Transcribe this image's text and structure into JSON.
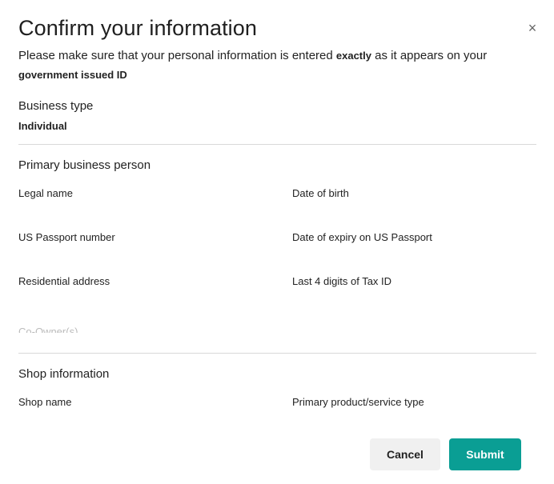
{
  "dialog": {
    "title": "Confirm your information",
    "close_glyph": "×",
    "subtitle_before": "Please make sure that your personal information is entered ",
    "subtitle_emphasis": "exactly",
    "subtitle_after": " as it appears on your ",
    "subtitle_line2": "government issued ID"
  },
  "business": {
    "heading": "Business type",
    "value": "Individual"
  },
  "primary_person": {
    "heading": "Primary business person",
    "fields": {
      "legal_name": "Legal name",
      "date_of_birth": "Date of birth",
      "passport_number": "US Passport number",
      "passport_expiry": "Date of expiry on US Passport",
      "residential_address": "Residential address",
      "tax_id": "Last 4 digits of Tax ID"
    },
    "faded_text": "Co-Owner(s)"
  },
  "shop": {
    "heading": "Shop information",
    "fields": {
      "shop_name": "Shop name",
      "product_type": "Primary product/service type"
    }
  },
  "actions": {
    "cancel_label": "Cancel",
    "submit_label": "Submit"
  },
  "colors": {
    "accent": "#0a9e94",
    "cancel_bg": "#f0f0f0",
    "divider": "#d9d9d9"
  },
  "icons": {
    "close": "close-icon"
  }
}
